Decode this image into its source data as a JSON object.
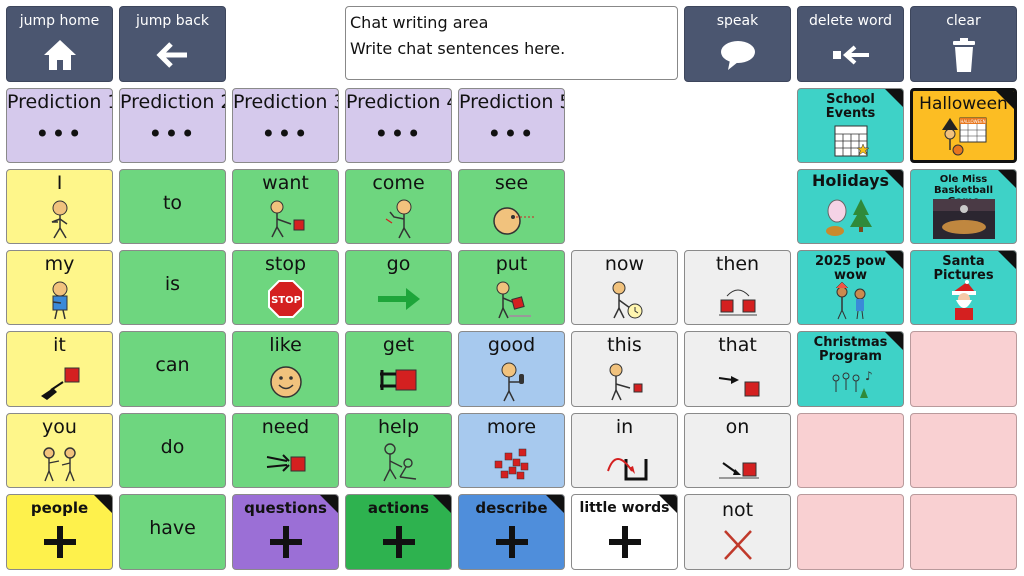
{
  "toolbar": {
    "jump_home": "jump home",
    "jump_back": "jump back",
    "speak": "speak",
    "delete_word": "delete word",
    "clear": "clear"
  },
  "chat": {
    "title": "Chat writing area",
    "placeholder": "Write chat sentences here."
  },
  "predictions": [
    "Prediction 1",
    "Prediction 2",
    "Prediction 3",
    "Prediction 4",
    "Prediction 5"
  ],
  "prediction_dots": "•••",
  "folders": {
    "school_events": "School Events",
    "halloween": "Halloween",
    "holidays": "Holidays",
    "ole_miss": "Ole Miss Basketball Game",
    "pow_wow": "2025 pow wow",
    "santa": "Santa Pictures",
    "christmas": "Christmas Program"
  },
  "words": {
    "i": "I",
    "to": "to",
    "want": "want",
    "come": "come",
    "see": "see",
    "my": "my",
    "is": "is",
    "stop": "stop",
    "go": "go",
    "put": "put",
    "now": "now",
    "then": "then",
    "it": "it",
    "can": "can",
    "like": "like",
    "get": "get",
    "good": "good",
    "this": "this",
    "that": "that",
    "you": "you",
    "do": "do",
    "need": "need",
    "help": "help",
    "more": "more",
    "in": "in",
    "on": "on",
    "have": "have",
    "not": "not"
  },
  "categories": {
    "people": "people",
    "questions": "questions",
    "actions": "actions",
    "describe": "describe",
    "little_words": "little words"
  },
  "symbol_text": {
    "stop_sign": "STOP",
    "halloween_calendar": "HALLOWEEN"
  },
  "colors": {
    "nav": "#4b5670",
    "prediction": "#d5c9ec",
    "pronoun_yellow": "#fef68a",
    "verb_green": "#6ed67f",
    "describe_blue": "#a7c9ee",
    "little_gray": "#efefef",
    "folder_teal": "#3ed2c7",
    "halloween_orange": "#fcbd23",
    "empty_pink": "#f9d0d2"
  }
}
